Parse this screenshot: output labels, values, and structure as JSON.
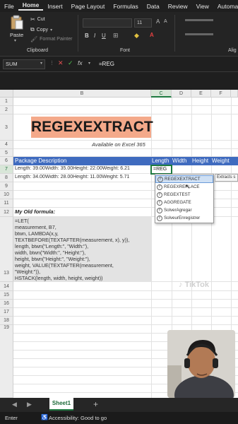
{
  "menu": [
    "File",
    "Home",
    "Insert",
    "Page Layout",
    "Formulas",
    "Data",
    "Review",
    "View",
    "Automate"
  ],
  "ribbon": {
    "paste": "Paste",
    "cut": "Cut",
    "copy": "Copy",
    "format_painter": "Format Painter",
    "clipboard_label": "Clipboard",
    "font_size": "11",
    "font_label": "Font",
    "align_label": "Alig"
  },
  "formula_bar": {
    "name_box": "SUM",
    "fx": "fx",
    "formula": "=REG"
  },
  "columns": [
    "B",
    "C",
    "D",
    "E",
    "F"
  ],
  "rows": [
    "1",
    "2",
    "3",
    "4",
    "5",
    "6",
    "7",
    "8",
    "9",
    "10",
    "11",
    "12",
    "13",
    "14",
    "15",
    "16",
    "17",
    "18",
    "19"
  ],
  "title": "REGEXEXTRACT",
  "subtitle": "Available on Excel 365",
  "table": {
    "headers": [
      "Package Description",
      "Length",
      "Width",
      "Height",
      "Weight"
    ],
    "rows": [
      "Length: 39.00Width: 35.00Height: 22.00Weight: 6.21",
      "Length: 34.00Width: 28.00Height: 11.00Weight: 5.71"
    ],
    "active_cell_text": "=REG"
  },
  "old_formula": {
    "heading": "My Old formula:",
    "lines": [
      "=LET(",
      "measurement, B7,",
      "btwn, LAMBDA(x,y,",
      "TEXTBEFORE(TEXTAFTER(measurement, x), y)),",
      "length, btwn(\"Length:\", \"Width:\"),",
      "width, btwn(\"Width:\", \"Height:\"),",
      "height, btwn(\"Height:\", \"Weight:\"),",
      "weight, VALUE(TEXTAFTER(measurement,",
      "\"Weight:\")),",
      "HSTACK(length, width, height, weight))"
    ]
  },
  "autocomplete": {
    "items": [
      "REGEXEXTRACT",
      "REGEXREPLACE",
      "REGEXTEST",
      "AGGREGATE",
      "SolverAgregar",
      "SolveurEnregistrer"
    ],
    "tooltip": "Extracts s"
  },
  "sheet_tab": "Sheet1",
  "status": {
    "mode": "Enter",
    "accessibility": "Accessibility: Good to go"
  },
  "watermark": "TikTok"
}
